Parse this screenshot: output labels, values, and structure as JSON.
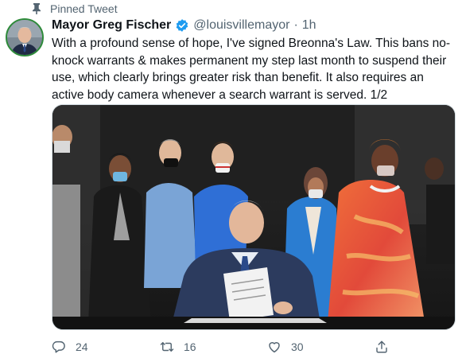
{
  "pinned": {
    "label": "Pinned Tweet",
    "icon": "pin-icon"
  },
  "author": {
    "display_name": "Mayor Greg Fischer",
    "handle": "@louisvillemayor",
    "separator": "·",
    "time": "1h",
    "verified_icon": "verified-badge-icon",
    "avatar_border_color": "#2e8b3a"
  },
  "tweet": {
    "text": "With a profound sense of hope, I've signed Breonna's Law. This bans no-knock warrants & makes permanent my step last month to suspend their use, which clearly brings greater risk than benefit. It also requires an active body camera whenever a search warrant is served. 1/2"
  },
  "media": {
    "type": "photo"
  },
  "actions": [
    {
      "name": "reply",
      "icon": "reply-icon",
      "count": "24"
    },
    {
      "name": "retweet",
      "icon": "retweet-icon",
      "count": "16"
    },
    {
      "name": "like",
      "icon": "heart-icon",
      "count": "30"
    },
    {
      "name": "share",
      "icon": "share-icon",
      "count": ""
    }
  ],
  "colors": {
    "verified": "#1d9bf0",
    "secondary_text": "#536471",
    "primary_text": "#0f1419"
  }
}
